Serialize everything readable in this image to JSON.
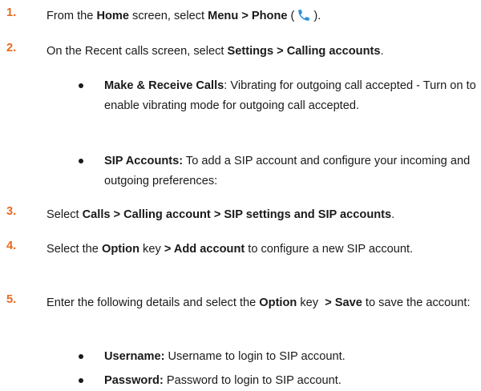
{
  "steps": [
    {
      "number": "1.",
      "parts": [
        {
          "text": "From the ",
          "bold": false
        },
        {
          "text": "Home",
          "bold": true
        },
        {
          "text": " screen, select ",
          "bold": false
        },
        {
          "text": "Menu > Phone",
          "bold": true
        },
        {
          "text": " (",
          "bold": false
        },
        {
          "icon": "phone-icon"
        },
        {
          "text": ").",
          "bold": false
        }
      ]
    },
    {
      "number": "2.",
      "parts": [
        {
          "text": "On the Recent calls screen, select ",
          "bold": false
        },
        {
          "text": "Settings > Calling accounts",
          "bold": true
        },
        {
          "text": ".",
          "bold": false
        }
      ],
      "bullets": [
        [
          {
            "text": "Make & Receive Calls",
            "bold": true
          },
          {
            "text": ": Vibrating for outgoing call accepted - Turn on to enable vibrating mode for outgoing call accepted.",
            "bold": false
          }
        ],
        [
          {
            "text": "SIP Accounts:",
            "bold": true
          },
          {
            "text": " To add a SIP account and configure your incoming and outgoing preferences:",
            "bold": false
          }
        ]
      ]
    },
    {
      "number": "3.",
      "parts": [
        {
          "text": "Select ",
          "bold": false
        },
        {
          "text": "Calls > Calling account > SIP settings and SIP accounts",
          "bold": true
        },
        {
          "text": ".",
          "bold": false
        }
      ]
    },
    {
      "number": "4.",
      "parts": [
        {
          "text": "Select the ",
          "bold": false
        },
        {
          "text": "Option",
          "bold": true
        },
        {
          "text": " key ",
          "bold": false
        },
        {
          "text": "> Add account",
          "bold": true
        },
        {
          "text": " to configure a new SIP account.",
          "bold": false
        }
      ]
    },
    {
      "number": "5.",
      "parts": [
        {
          "text": "Enter the following details and select the ",
          "bold": false
        },
        {
          "text": "Option",
          "bold": true
        },
        {
          "text": " key  ",
          "bold": false
        },
        {
          "text": "> Save",
          "bold": true
        },
        {
          "text": " to save the account:",
          "bold": false
        }
      ],
      "bullets": [
        [
          {
            "text": "Username:",
            "bold": true
          },
          {
            "text": " Username to login to SIP account.",
            "bold": false
          }
        ],
        [
          {
            "text": "Password:",
            "bold": true
          },
          {
            "text": " Password to login to SIP account.",
            "bold": false
          }
        ]
      ]
    }
  ],
  "colors": {
    "step_number": "#e8691e",
    "phone_icon": "#2a8fd8"
  }
}
